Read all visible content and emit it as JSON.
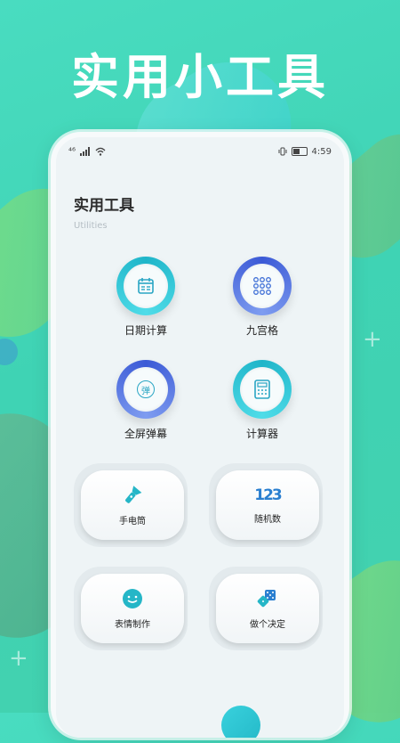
{
  "headline": "实用小工具",
  "statusbar": {
    "signal_text": "⁴⁶",
    "time": "4:59"
  },
  "page": {
    "title": "实用工具",
    "subtitle": "Utilities"
  },
  "round_tools": [
    {
      "label": "日期计算",
      "icon": "calendar-icon",
      "ring": "teal"
    },
    {
      "label": "九宫格",
      "icon": "grid-icon",
      "ring": "blue"
    },
    {
      "label": "全屏弹幕",
      "icon": "danmaku-icon",
      "ring": "blue"
    },
    {
      "label": "计算器",
      "icon": "calculator-icon",
      "ring": "teal"
    }
  ],
  "card_tools": [
    {
      "label": "手电筒",
      "icon": "flashlight-icon"
    },
    {
      "label": "随机数",
      "icon": "random-number-icon",
      "glyph": "123"
    },
    {
      "label": "表情制作",
      "icon": "emoji-icon"
    },
    {
      "label": "做个决定",
      "icon": "dice-icon"
    }
  ],
  "icon_glyphs": {
    "danmaku": "弹"
  },
  "colors": {
    "teal": "#1fb5c9",
    "blue": "#3b5ad6",
    "background": "#43d4b6"
  }
}
